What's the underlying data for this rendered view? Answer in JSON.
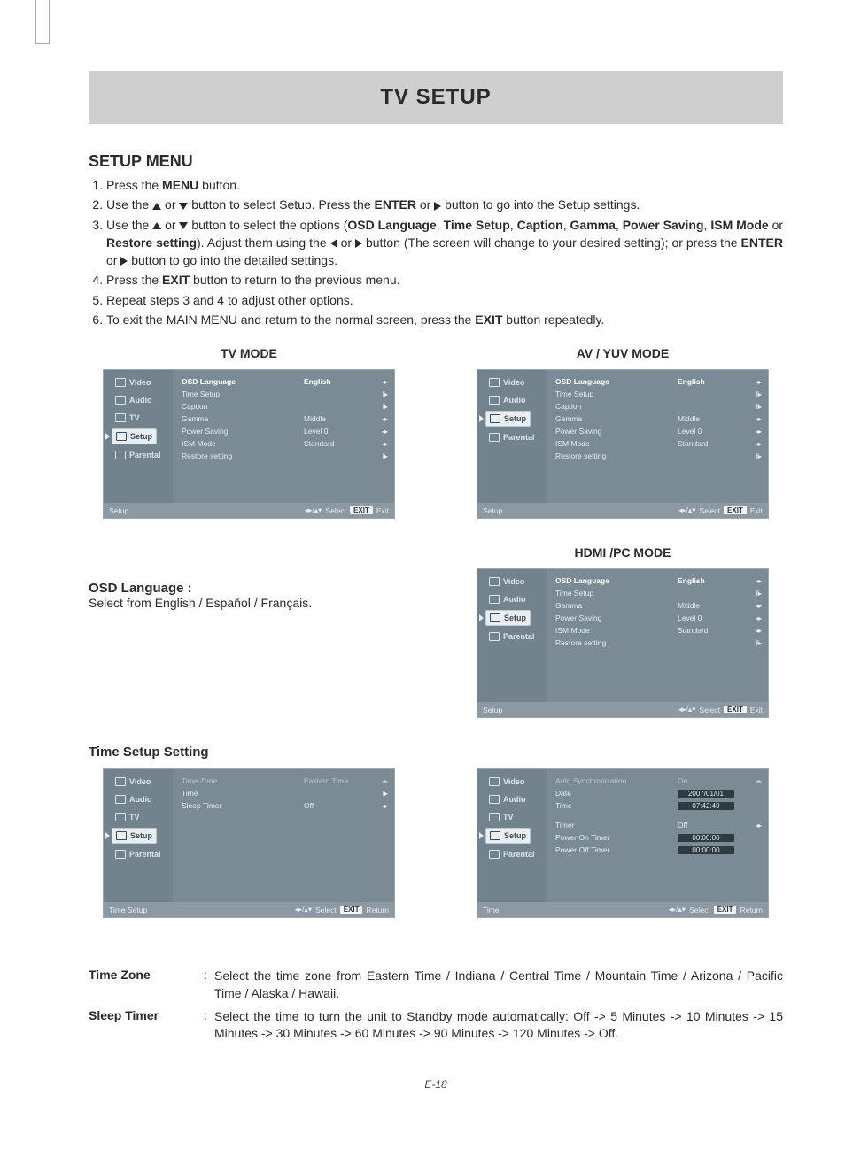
{
  "page": {
    "title": "TV SETUP",
    "section_heading": "SETUP MENU",
    "pagenum": "E-18"
  },
  "steps": {
    "s1a": "Press the ",
    "s1b": "MENU",
    "s1c": " button.",
    "s2a": "Use the ",
    "s2b": " or ",
    "s2c": " button to select Setup. Press the ",
    "s2d": "ENTER",
    "s2e": " or ",
    "s2f": " button to go into the Setup settings.",
    "s3a": "Use the ",
    "s3b": " or ",
    "s3c": " button to select the options (",
    "s3d": "OSD Language",
    "s3e": ", ",
    "s3f": "Time Setup",
    "s3g": ", ",
    "s3h": "Caption",
    "s3i": ", ",
    "s3j": "Gamma",
    "s3k": ", ",
    "s3l": "Power Saving",
    "s3m": ", ",
    "s3n": "ISM Mode",
    "s3o": " or ",
    "s3p": "Restore setting",
    "s3q": "). Adjust them using the ",
    "s3r": " or ",
    "s3s": " button (The screen will change to your desired setting); or press the ",
    "s3t": "ENTER",
    "s3u": " or ",
    "s3v": " button to go into the detailed settings.",
    "s4a": "Press the ",
    "s4b": "EXIT",
    "s4c": " button to return to the previous menu.",
    "s5": "Repeat steps 3 and 4 to adjust other options.",
    "s6a": "To exit the MAIN MENU and return to the normal screen, press the ",
    "s6b": "EXIT",
    "s6c": " button repeatedly."
  },
  "modes": {
    "tv": "TV  MODE",
    "av": "AV / YUV MODE",
    "hdmi": "HDMI /PC MODE"
  },
  "sidebar": {
    "video": "Video",
    "audio": "Audio",
    "tv": "TV",
    "setup": "Setup",
    "parental": "Parental"
  },
  "osd_tv": {
    "r1l": "OSD Language",
    "r1v": "English",
    "r1c": "◂▸",
    "r2l": "Time Setup",
    "r2v": "",
    "r2c": "‖▸",
    "r3l": "Caption",
    "r3v": "",
    "r3c": "‖▸",
    "r4l": "Gamma",
    "r4v": "Middle",
    "r4c": "◂▸",
    "r5l": "Power Saving",
    "r5v": "Level 0",
    "r5c": "◂▸",
    "r6l": "ISM Mode",
    "r6v": "Standard",
    "r6c": "◂▸",
    "r7l": "Restore setting",
    "r7v": "",
    "r7c": "‖▸"
  },
  "osd_av": {
    "r1l": "OSD Language",
    "r1v": "English",
    "r1c": "◂▸",
    "r2l": "Time Setup",
    "r2v": "",
    "r2c": "‖▸",
    "r3l": "Caption",
    "r3v": "",
    "r3c": "‖▸",
    "r4l": "Gamma",
    "r4v": "Middle",
    "r4c": "◂▸",
    "r5l": "Power Saving",
    "r5v": "Level 0",
    "r5c": "◂▸",
    "r6l": "ISM Mode",
    "r6v": "Standard",
    "r6c": "◂▸",
    "r7l": "Restore setting",
    "r7v": "",
    "r7c": "‖▸"
  },
  "osd_hdmi": {
    "r1l": "OSD Language",
    "r1v": "English",
    "r1c": "◂▸",
    "r2l": "Time Setup",
    "r2v": "",
    "r2c": "‖▸",
    "r3l": "Gamma",
    "r3v": "Middle",
    "r3c": "◂▸",
    "r4l": "Power Saving",
    "r4v": "Level 0",
    "r4c": "◂▸",
    "r5l": "ISM Mode",
    "r5v": "Standard",
    "r5c": "◂▸",
    "r6l": "Restore setting",
    "r6v": "",
    "r6c": "‖▸"
  },
  "osd_footer": {
    "title_setup": "Setup",
    "title_timesetup": "Time Setup",
    "title_time": "Time",
    "nav": "◂▸/▴▾",
    "select": "Select",
    "exit": "EXIT",
    "exit_lbl": "Exit",
    "return_lbl": "Return"
  },
  "osd_time1": {
    "r1l": "Time Zone",
    "r1v": "Eastern Time",
    "r1c": "◂▸",
    "r2l": "Time",
    "r2v": "",
    "r2c": "‖▸",
    "r3l": "Sleep Timer",
    "r3v": "Off",
    "r3c": "◂▸"
  },
  "osd_time2": {
    "r1l": "Auto Synchronization",
    "r1v": "On",
    "r1c": "◂▸",
    "r2l": "Date",
    "r2v": "2007/01/01",
    "r3l": "Time",
    "r3v": "07:42:49",
    "r4l": "Timer",
    "r4v": "Off",
    "r4c": "◂▸",
    "r5l": "Power On Timer",
    "r5v": "00:00:00",
    "r6l": "Power Off Timer",
    "r6v": "00:00:00"
  },
  "osd_lang": {
    "heading": "OSD Language :",
    "desc": "Select from English / Espaňol / Français."
  },
  "time_heading": "Time Setup Setting",
  "defs": {
    "tz_term": "Time Zone",
    "tz_desc": "Select the time zone from Eastern Time / Indiana / Central Time / Mountain Time / Arizona / Pacific Time / Alaska / Hawaii.",
    "st_term": "Sleep Timer",
    "st_desc": "Select the time to turn the unit to Standby mode automatically: Off -> 5 Minutes -> 10 Minutes -> 15 Minutes -> 30 Minutes -> 60 Minutes -> 90 Minutes -> 120 Minutes  -> Off."
  }
}
